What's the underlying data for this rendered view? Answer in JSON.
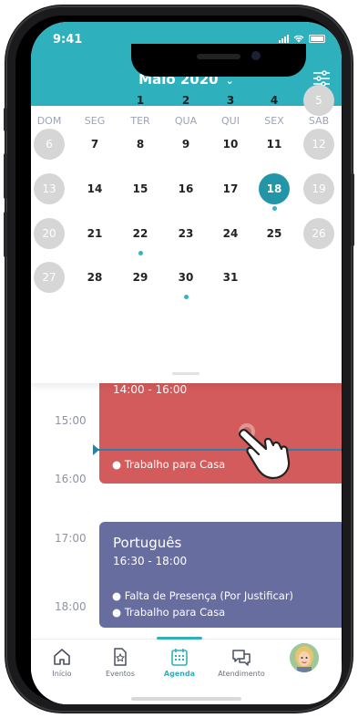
{
  "status": {
    "time": "9:41"
  },
  "header": {
    "month": "Maio 2020"
  },
  "weekdays": [
    "DOM",
    "SEG",
    "TER",
    "QUA",
    "QUI",
    "SEX",
    "SAB"
  ],
  "weeks": [
    [
      "",
      "",
      "1",
      "2",
      "3",
      "4",
      "5"
    ],
    [
      "6",
      "7",
      "8",
      "9",
      "10",
      "11",
      "12"
    ],
    [
      "13",
      "14",
      "15",
      "16",
      "17",
      "18",
      "19"
    ],
    [
      "20",
      "21",
      "22",
      "23",
      "24",
      "25",
      "26"
    ],
    [
      "27",
      "28",
      "29",
      "30",
      "31",
      "",
      ""
    ]
  ],
  "selected_day": "18",
  "days_with_events": [
    "18",
    "22",
    "30"
  ],
  "agenda": {
    "times": [
      "15:00",
      "16:00",
      "17:00",
      "18:00"
    ],
    "events": [
      {
        "time": "14:00 - 16:00",
        "items": [
          "Trabalho para Casa"
        ]
      },
      {
        "title": "Português",
        "time": "16:30 - 18:00",
        "items": [
          "Falta de Presença (Por Justificar)",
          "Trabalho para Casa"
        ]
      }
    ]
  },
  "tabs": [
    {
      "label": "Início",
      "icon": "home-icon"
    },
    {
      "label": "Eventos",
      "icon": "event-doc-icon"
    },
    {
      "label": "Agenda",
      "icon": "calendar-icon",
      "active": true
    },
    {
      "label": "Atendimento",
      "icon": "chat-icon"
    },
    {
      "label": "",
      "icon": "avatar"
    }
  ],
  "colors": {
    "accent": "#2fb0bd",
    "selected_day": "#2296a8",
    "event_red": "#d45b5b",
    "event_blue": "#686d9f"
  }
}
